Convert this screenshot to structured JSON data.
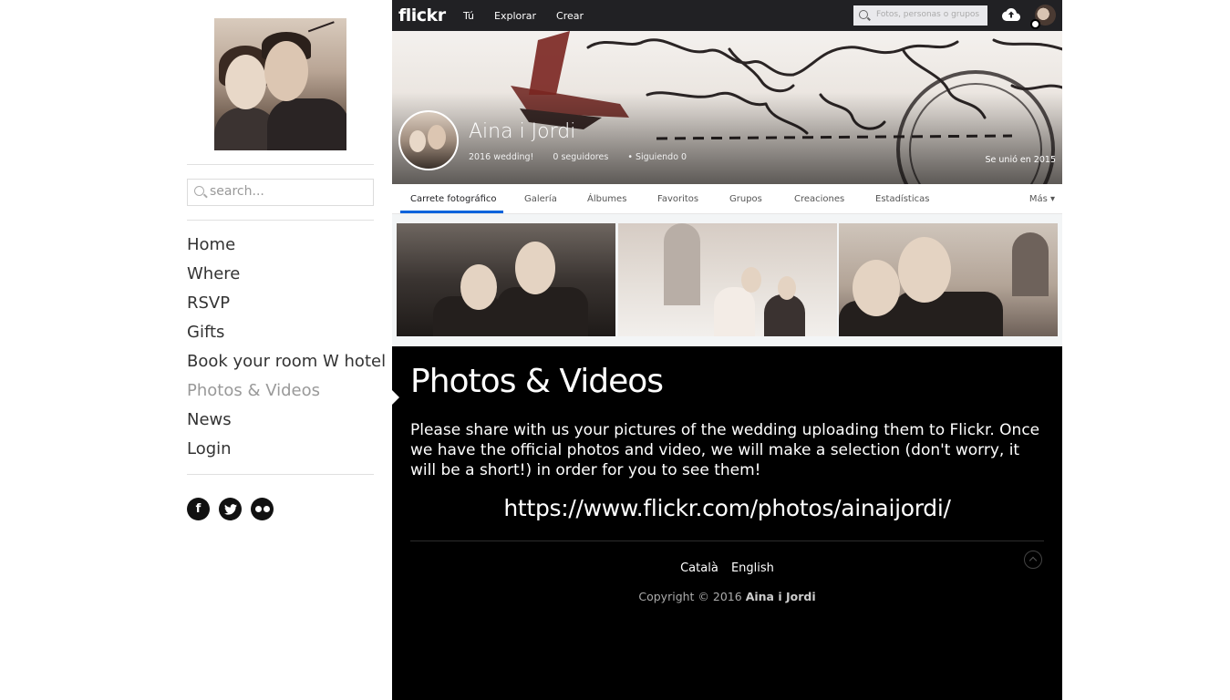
{
  "sidebar": {
    "search_placeholder": "search...",
    "nav": [
      "Home",
      "Where",
      "RSVP",
      "Gifts",
      "Book your room W hotel",
      "Photos & Videos",
      "News",
      "Login"
    ],
    "active_item": "Photos & Videos",
    "social": [
      "facebook-icon",
      "twitter-icon",
      "flickr-icon"
    ]
  },
  "flickr": {
    "logo": "flickr",
    "topnav": [
      "Tú",
      "Explorar",
      "Crear"
    ],
    "search_placeholder": "Fotos, personas o grupos",
    "profile": {
      "name": "Aina i Jordi",
      "tagline": "2016 wedding!",
      "followers": "0 seguidores",
      "following": "Siguiendo 0",
      "joined": "Se unió en 2015"
    },
    "tabs": [
      "Carrete fotográfico",
      "Galería",
      "Álbumes",
      "Favoritos",
      "Grupos",
      "Creaciones",
      "Estadísticas"
    ],
    "active_tab": "Carrete fotográfico",
    "more": "Más ▾"
  },
  "page": {
    "title": "Photos & Videos",
    "body": "Please share with us your pictures of the wedding uploading them to Flickr. Once we have the official photos and video, we will make a selection (don't worry, it will be a short!) in order for you to see them!",
    "url": "https://www.flickr.com/photos/ainaijordi/"
  },
  "footer": {
    "languages": [
      "Català",
      "English"
    ],
    "copyright_prefix": "Copyright © 2016",
    "copyright_owner": "Aina i Jordi"
  },
  "colors": {
    "accent_tab": "#0063dc",
    "topbar": "#212124",
    "main_bg": "#000000"
  }
}
